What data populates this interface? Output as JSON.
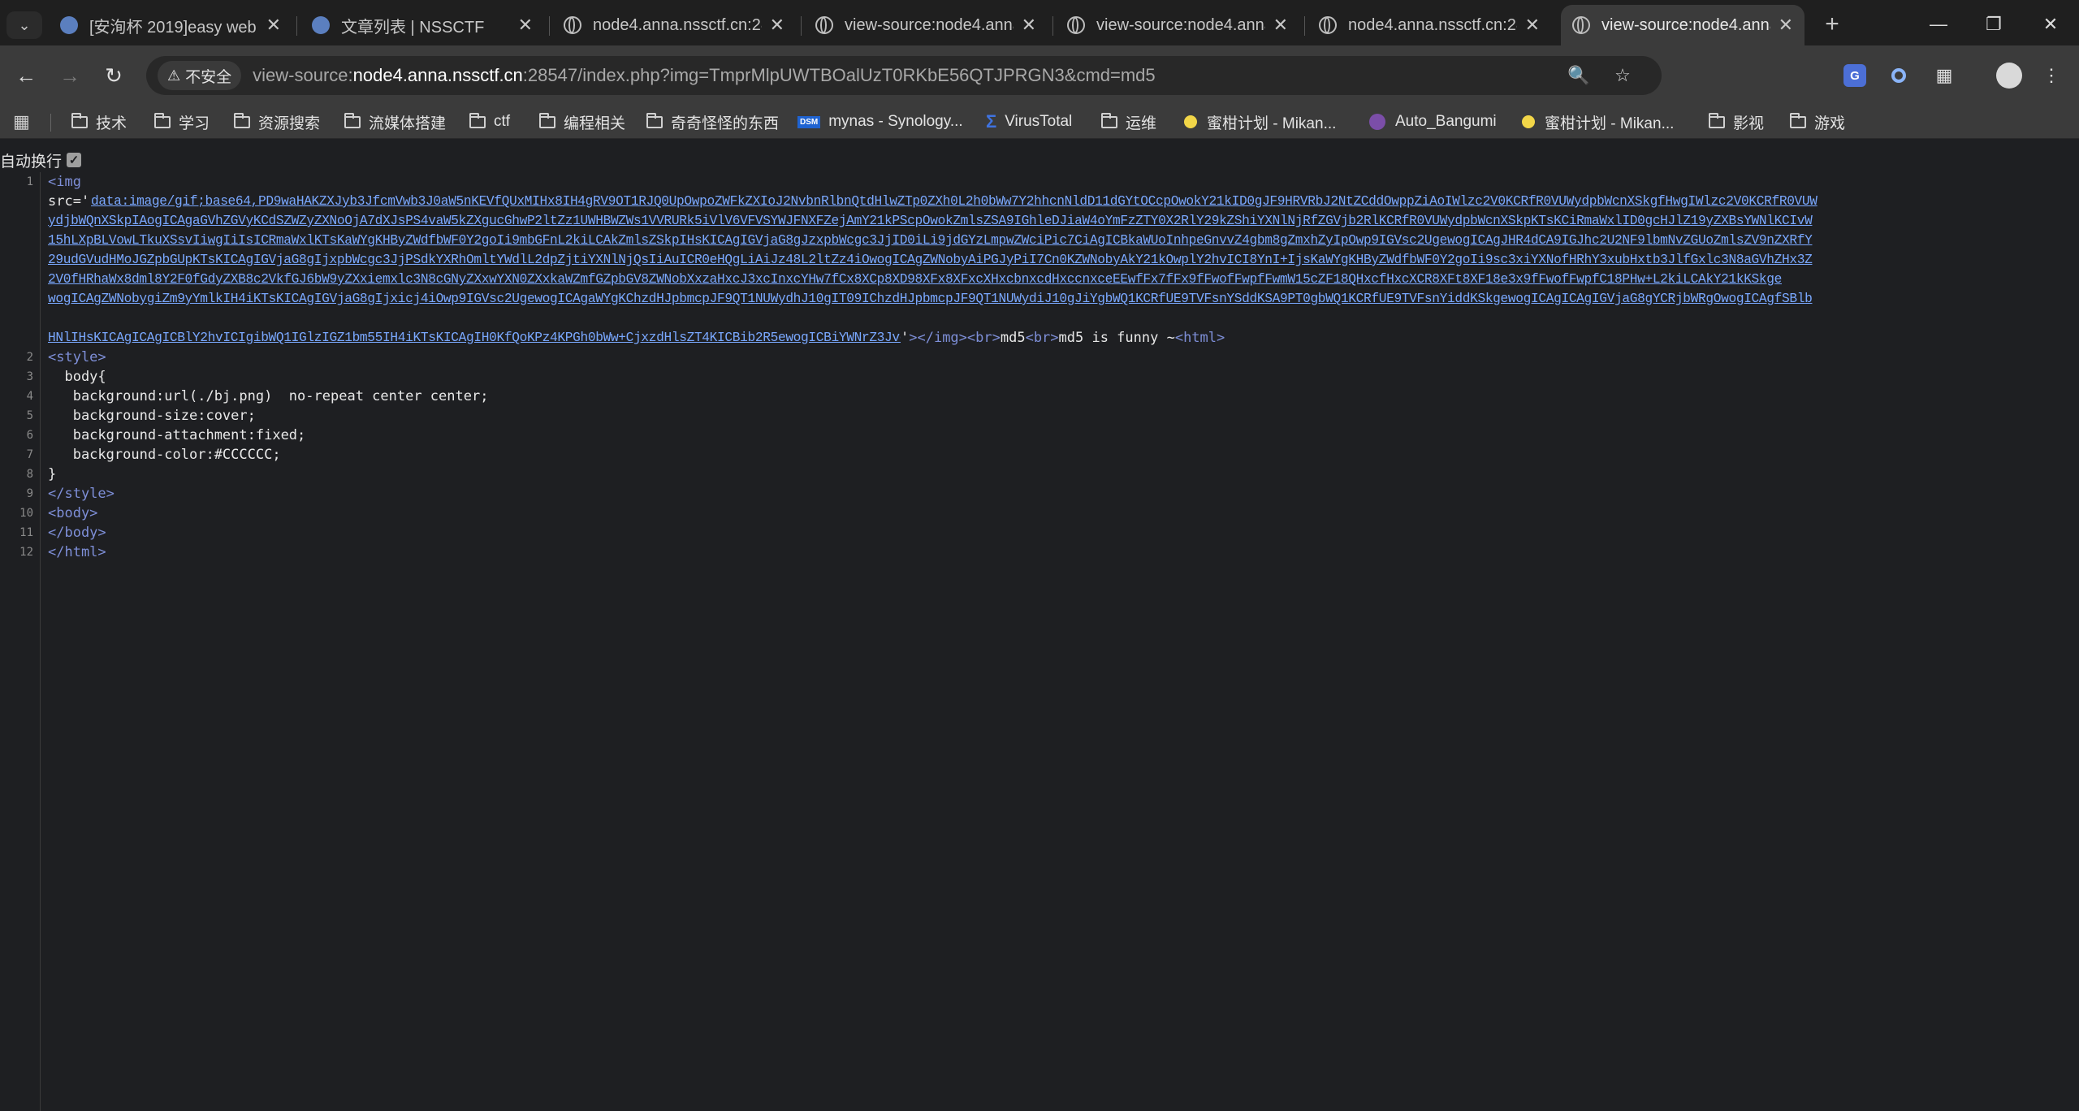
{
  "tabs": [
    {
      "title": "[安洵杯 2019]easy web |",
      "favicon": "nss-icon",
      "active": false
    },
    {
      "title": "文章列表 | NSSCTF",
      "favicon": "nss-icon",
      "active": false
    },
    {
      "title": "node4.anna.nssctf.cn:28",
      "favicon": "globe-icon",
      "active": false
    },
    {
      "title": "view-source:node4.anna.",
      "favicon": "globe-icon",
      "active": false
    },
    {
      "title": "view-source:node4.anna.",
      "favicon": "globe-icon",
      "active": false
    },
    {
      "title": "node4.anna.nssctf.cn:28",
      "favicon": "globe-icon",
      "active": false
    },
    {
      "title": "view-source:node4.anna.",
      "favicon": "globe-icon",
      "active": true
    }
  ],
  "omnibox": {
    "security_label": "不安全",
    "url_prefix": "view-source:",
    "url_host": "node4.anna.nssctf.cn",
    "url_rest": ":28547/index.php?img=TmprMlpUWTBOalUzT0RKbE56QTJPRGN3&cmd=md5"
  },
  "bookmarks": [
    {
      "label": "技术",
      "icon": "folder-icon"
    },
    {
      "label": "学习",
      "icon": "folder-icon"
    },
    {
      "label": "资源搜索",
      "icon": "folder-icon"
    },
    {
      "label": "流媒体搭建",
      "icon": "folder-icon"
    },
    {
      "label": "ctf",
      "icon": "folder-icon"
    },
    {
      "label": "编程相关",
      "icon": "folder-icon"
    },
    {
      "label": "奇奇怪怪的东西",
      "icon": "folder-icon"
    },
    {
      "label": "mynas - Synology...",
      "icon": "dsm-icon"
    },
    {
      "label": "VirusTotal",
      "icon": "virustotal-icon"
    },
    {
      "label": "运维",
      "icon": "folder-icon"
    },
    {
      "label": "蜜柑计划 - Mikan...",
      "icon": "mikan-icon"
    },
    {
      "label": "Auto_Bangumi",
      "icon": "bangumi-icon"
    },
    {
      "label": "蜜柑计划 - Mikan...",
      "icon": "mikan-icon"
    },
    {
      "label": "影视",
      "icon": "folder-icon"
    },
    {
      "label": "游戏",
      "icon": "folder-icon"
    }
  ],
  "wrap_label": "自动换行",
  "source": {
    "line_numbers": [
      "1",
      "2",
      "3",
      "4",
      "5",
      "6",
      "7",
      "8",
      "9",
      "10",
      "11",
      "12"
    ],
    "img_open": "<img",
    "src_attr": "src='",
    "b64_lines": [
      "data:image/gif;base64,PD9waHAKZXJyb3JfcmVwb3J0aW5nKEVfQUxMIHx8IH4gRV9OT1RJQ0UpOwpoZWFkZXIoJ2NvbnRlbnQtdHlwZTp0ZXh0L2h0bWw7Y2hhcnNldD11dGYtOCcpOwokY21kID0gJF9HRVRbJ2NtZCddOwppZiAoIWlzc2V0KCRfR0VUWydpbWcnXSkgfHwgIWlzc2V0KCRfR0VUW",
      "ydjbWQnXSkpIAogICAgaGVhZGVyKCdSZWZyZXNoOjA7dXJsPS4vaW5kZXgucGhwP2ltZz1UWHBWZWs1VVRURk5iVlV6VFVSYWJFNXFZejAmY21kPScpOwokZmlsZSA9IGhleDJiaW4oYmFzZTY0X2RlY29kZShiYXNlNjRfZGVjb2RlKCRfR0VUWydpbWcnXSkpKTsKCiRmaWxlID0gcHJlZ19yZXBsYWNlKCIvW",
      "15hLXpBLVowLTkuXSsvIiwgIiIsICRmaWxlKTsKaWYgKHByZWdfbWF0Y2goIi9mbGFnL2kiLCAkZmlsZSkpIHsKICAgIGVjaG8gJzxpbWcgc3JjID0iLi9jdGYzLmpwZWciPic7CiAgICBkaWUoInhpeGnvvZ4gbm8gZmxhZyIpOwp9IGVsc2UgewogICAgJHR4dCA9IGJhc2U2NF9lbmNvZGUoZmlsZV9nZXRfY",
      "29udGVudHMoJGZpbGUpKTsKICAgIGVjaG8gIjxpbWcgc3JjPSdkYXRhOmltYWdlL2dpZjtiYXNlNjQsIiAuICR0eHQgLiAiJz48L2ltZz4iOwogICAgZWNobyAiPGJyPiI7Cn0KZWNobyAkY21kOwplY2hvICI8YnI+IjsKaWYgKHByZWdfbWF0Y2goIi9sc3xiYXNofHRhY3xubHxtb3JlfGxlc3N8aGVhZHx3Z",
      "2V0fHRhaWx8dmltfGNhdHxtb3JlfGxlc3N8aGVhZHxtb3JlfG1vcmUoemxjfGxlc3N8cGNyZXxwYXNOZXxkaWZmZGVpbGV8Nob3xzaHxcJ3xcInxcYHw7fCx8XCp8XD98XFx8XFxcXHxcbnxcdHxccnxceEEwfFx7fFx9fFwofFwpfFwmW15cZF18QHxcfHxcXCR8XFt8XF18e3x9fFwofFwpfC18PHw+L2kiLCAkY21kKSkgewogICAgZWNobyIrZm9vYmlkIH4iKTsKICAgIGVjaG8gIjxicj4iOwp9IGVsc2UgewogICAgaWYgKChzdHJpbmcpJF9QT1NUWydhJ10gIT09IChzdHJpbmcpJF9QT1NUWydiJ10gJiYgbWQ1KCRfUE9TVFsnYSddKSA9PT0gbWQ1KCRfUE9TVFsnYiddKSkgewogICAgICAgIGVjaG8gYCRjbWRgOwogICAgfSBlbHNlIHsKICAgICAgICBlY2hvICIgibWQ1IGlzIGZ1bm55IH4iKTsKICAgIH0KfQoKPz4KPGh0bWw+CjxzdHlsZT4KICBib2R5ewogICBiYWNrZ3JvdW5kOnVybCguL2JqLnBuZykgIG5vLXJlcGVhdCBjZW50ZXIgY2VudGVyOwogICBiYWNrZ3JvdW5kLXNpemU6Y292ZXI7CiAgIGJhY2tncm91bmQtYXR0YWNobWVudDpmaXhlZDsKICAgYmFja2dyb3VuZC1jb2xvcjojQ0NDQ0NDOwp9Cjwvc3R5bGU+Cjxib2R5Pgo8L2JvZHk+CjwvaHRtbD4="
    ],
    "b64_display": [
      "data:image/gif;base64,PD9waHAKZXJyb3JfcmVwb3J0aW5nKEVfQUxMIHx8IH4gRV9OT1RJQ0UpOwpoZWFkZXIoJ2NvbnRlbnQtdHlwZTp0ZXh0L2h0bWw7Y2hhcnNldD11dGYtOCcpOwokY21kID0gJF9HRVRbJ2NtZCddOwppZiAoIWlzc2V0KCRfR0VUWydpbWcnXSkgfHwgIWlzc2V0KCRfR0VUW",
      "ydjbWQnXSkpIAogICAgaGVhZGVyKCdSZWZyZXNoOjA7dXJsPS4vaW5kZXgucGhwP2ltZz1UWHBWZWs1VVRURk5iVlV6VFVSYWJFNXFZejAmY21kPScpOwokZmlsZSA9IGhleDJiaW4oYmFzZTY0X2RlY29kZShiYXNlNjRfZGVjb2RlKCRfR0VUWydpbWcnXSkpKTsKCiRmaWxlID0gcHJlZ19yZXBsYWNlKCIvW",
      "15hLXpBLVowLTkuXSsvIiwgIiIsICRmaWxlKTsKaWYgKHByZWdfbWF0Y2goIi9mbGFnL2kiLCAkZmlsZSkpIHsKICAgIGVjaG8gJzxpbWcgc3JjID0iLi9jdGYzLmpwZWciPic7CiAgICBkaWUoInhpeGnvvZ4gbm8gZmxhZyIpOwp9IGVsc2UgewogICAgJHR4dCA9IGJhc2U2NF9lbmNvZGUoZmlsZV9nZXRfY",
      "29udGVudHMoJGZpbGUpKTsKICAgIGVjaG8gIjxpbWcgc3JjPSdkYXRhOmltYWdlL2dpZjtiYXNlNjQsIiAuICR0eHQgLiAiJz48L2ltZz4iOwogICAgZWNobyAiPGJyPiI7Cn0KZWNobyAkY21kOwplY2hvICI8YnI+IjsKaWYgKHByZWdfbWF0Y2goIi9sc3xiYXNofHRhY3xubHxtb3JlfGxlc3N8aGVhZHx3Z",
      "2V0fHRhaWx8dml8Y2F0fGdyZXB8c2VkfGJ6bW9yZXxiemxlc3N8cGNyZXxwYXN0ZXxkaWZmfGZpbGV8ZWNobXxzaHxcJ3xcInxcYHw7fCx8XCp8XD98XFx8XFxcXHxcbnxcdHxccnxceEEwfFx7fFx9fFwofFwpfFwmW15cZF18QHxcfHxcXCR8XFt8XF18e3x9fFwofFwpfC18PHw+L2kiLCAkY21kKSkge",
      "wogICAgZWNobygiZm9yYmlkIH4iKTsKICAgIGVjaG8gIjxicj4iOwp9IGVsc2UgewogICAgaWYgKChzdHJpbmcpJF9QT1NUWydhJ10gIT09IChzdHJpbmcpJF9QT1NUWydiJ10gJiYgbWQ1KCRfUE9TVFsnYSddKSA9PT0gbWQ1KCRfUE9TVFsnYiddKSkgewogICAgICAgIGVjaG8gYCRjbWRgOwogICAgfSBlb",
      "HNlIHsKICAgICAgICBlY2hvICIgibWQ1IGlzIGZ1bm55IH4iKTsKICAgIH0KfQoKPz4KPGh0bWw+CjxzdHlsZT4KICBib2R5ewogICBiYWNrZ3JvdW5kOnVybCguL2JqLnBuZykgIG5vLXJlcGVhdCBjZW50ZXIgY2VudGVyOwogICBiYWNrZ3JvdW5kLXNpemU6Y292ZXI7CiAgIGJhY2tncm91bmQtYXR0YWNobWVudDpmaXhlZDsKICAgYmFja2dyb3VuZC1jb2xvcjojQ0NDQ0NDOwp9Cjwvc3R5bGU+Cjxib2R5Pgo8L2JvZHk+CjwvaHRtbD4="
    ],
    "line1_tail": {
      "quote_close": "'",
      "img_end": "></img>",
      "br1": "<br>",
      "text1": "md5",
      "br2": "<br>",
      "text2": "md5 is funny ~",
      "html_open": "<html>"
    },
    "lines": [
      {
        "parts": [
          {
            "t": "<style>",
            "c": "tag"
          }
        ]
      },
      {
        "parts": [
          {
            "t": "  body{",
            "c": "plain"
          }
        ]
      },
      {
        "parts": [
          {
            "t": "   background:url(./bj.png)  no-repeat center center;",
            "c": "plain"
          }
        ]
      },
      {
        "parts": [
          {
            "t": "   background-size:cover;",
            "c": "plain"
          }
        ]
      },
      {
        "parts": [
          {
            "t": "   background-attachment:fixed;",
            "c": "plain"
          }
        ]
      },
      {
        "parts": [
          {
            "t": "   background-color:#CCCCCC;",
            "c": "plain"
          }
        ]
      },
      {
        "parts": [
          {
            "t": "}",
            "c": "plain"
          }
        ]
      },
      {
        "parts": [
          {
            "t": "</style>",
            "c": "tag"
          }
        ]
      },
      {
        "parts": [
          {
            "t": "<body>",
            "c": "tag"
          }
        ]
      },
      {
        "parts": [
          {
            "t": "</body>",
            "c": "tag"
          }
        ]
      },
      {
        "parts": [
          {
            "t": "</html>",
            "c": "tag"
          }
        ]
      }
    ]
  }
}
